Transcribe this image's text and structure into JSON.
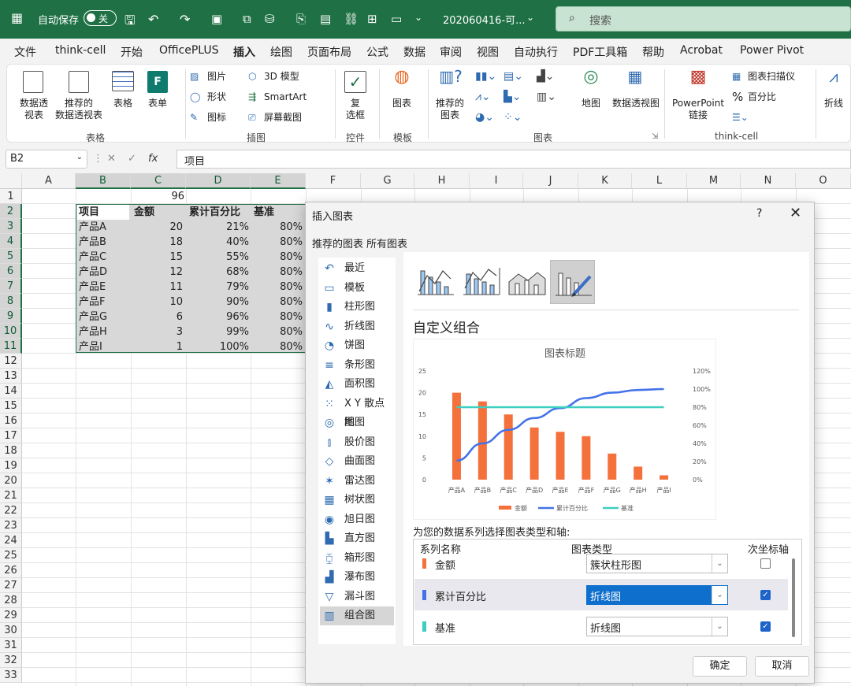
{
  "title_bar": {
    "autosave_label": "自动保存",
    "autosave_state": "关",
    "filename": "202060416-可...",
    "search_placeholder": "搜索"
  },
  "menu": [
    "文件",
    "think-cell",
    "开始",
    "OfficePLUS",
    "插入",
    "绘图",
    "页面布局",
    "公式",
    "数据",
    "审阅",
    "视图",
    "自动执行",
    "PDF工具箱",
    "帮助",
    "Acrobat",
    "Power Pivot"
  ],
  "menu_active": "插入",
  "ribbon": {
    "pivot_table": "数据透\n视表",
    "recommended_pivot": "推荐的\n数据透视表",
    "table": "表格",
    "form": "表单",
    "group_table": "表格",
    "pictures": "图片",
    "shapes": "形状",
    "icons": "图标",
    "model3d": "3D 模型",
    "smartart": "SmartArt",
    "screenshot": "屏幕截图",
    "group_illustrations": "插图",
    "checkbox": "复\n选框",
    "group_controls": "控件",
    "chart_template": "图表",
    "group_template": "模板",
    "recommended_charts": "推荐的\n图表",
    "maps": "地图",
    "pivot_chart": "数据透视图",
    "group_charts": "图表",
    "powerpoint_link": "PowerPoint\n链接",
    "chart_scanner": "图表扫描仪",
    "percent": "百分比",
    "group_thinkcell": "think-cell",
    "line_sparkline": "折线"
  },
  "formula_bar": {
    "name_box": "B2",
    "fx": "fx",
    "content": "项目"
  },
  "columns": [
    "A",
    "B",
    "C",
    "D",
    "E",
    "F",
    "G",
    "H",
    "I",
    "J",
    "K",
    "L",
    "M",
    "N",
    "O"
  ],
  "rows": [
    "1",
    "2",
    "3",
    "4",
    "5",
    "6",
    "7",
    "8",
    "9",
    "10",
    "11",
    "12",
    "13",
    "14",
    "15",
    "16",
    "17",
    "18",
    "19",
    "20",
    "21",
    "22",
    "23",
    "24",
    "25",
    "26",
    "27",
    "28",
    "29",
    "30",
    "31",
    "32",
    "33"
  ],
  "cell_c1": "96",
  "table_headers": [
    "项目",
    "金额",
    "累计百分比",
    "基准"
  ],
  "table_rows": [
    [
      "产品A",
      "20",
      "21%",
      "80%"
    ],
    [
      "产品B",
      "18",
      "40%",
      "80%"
    ],
    [
      "产品C",
      "15",
      "55%",
      "80%"
    ],
    [
      "产品D",
      "12",
      "68%",
      "80%"
    ],
    [
      "产品E",
      "11",
      "79%",
      "80%"
    ],
    [
      "产品F",
      "10",
      "90%",
      "80%"
    ],
    [
      "产品G",
      "6",
      "96%",
      "80%"
    ],
    [
      "产品H",
      "3",
      "99%",
      "80%"
    ],
    [
      "产品I",
      "1",
      "100%",
      "80%"
    ]
  ],
  "dialog": {
    "title": "插入图表",
    "help": "?",
    "close": "✕",
    "tab_recommended": "推荐的图表",
    "tab_all": "所有图表",
    "chart_types": [
      {
        "label": "最近",
        "icon": "↶"
      },
      {
        "label": "模板",
        "icon": "▭"
      },
      {
        "label": "柱形图",
        "icon": "▮"
      },
      {
        "label": "折线图",
        "icon": "∿"
      },
      {
        "label": "饼图",
        "icon": "◔"
      },
      {
        "label": "条形图",
        "icon": "≡"
      },
      {
        "label": "面积图",
        "icon": "◭"
      },
      {
        "label": "X Y 散点图",
        "icon": "⁙"
      },
      {
        "label": "地图",
        "icon": "◎"
      },
      {
        "label": "股价图",
        "icon": "⫾"
      },
      {
        "label": "曲面图",
        "icon": "◇"
      },
      {
        "label": "雷达图",
        "icon": "✶"
      },
      {
        "label": "树状图",
        "icon": "▦"
      },
      {
        "label": "旭日图",
        "icon": "◉"
      },
      {
        "label": "直方图",
        "icon": "▙"
      },
      {
        "label": "箱形图",
        "icon": "⧮"
      },
      {
        "label": "瀑布图",
        "icon": "▟"
      },
      {
        "label": "漏斗图",
        "icon": "▽"
      },
      {
        "label": "组合图",
        "icon": "▥"
      }
    ],
    "selected_type": "组合图",
    "subtype_heading": "自定义组合",
    "series_prompt": "为您的数据系列选择图表类型和轴:",
    "series_headers": [
      "系列名称",
      "图表类型",
      "次坐标轴"
    ],
    "series": [
      {
        "name": "金额",
        "color": "#f4713c",
        "chart_type": "簇状柱形图",
        "secondary_axis": false
      },
      {
        "name": "累计百分比",
        "color": "#4472e8",
        "chart_type": "折线图",
        "secondary_axis": true
      },
      {
        "name": "基准",
        "color": "#3ccfc0",
        "chart_type": "折线图",
        "secondary_axis": true
      }
    ],
    "ok": "确定",
    "cancel": "取消"
  },
  "chart_data": {
    "type": "bar",
    "title": "图表标题",
    "categories": [
      "产品A",
      "产品B",
      "产品C",
      "产品D",
      "产品E",
      "产品F",
      "产品G",
      "产品H",
      "产品I"
    ],
    "series": [
      {
        "name": "金额",
        "type": "bar",
        "axis": "primary",
        "color": "#f4713c",
        "values": [
          20,
          18,
          15,
          12,
          11,
          10,
          6,
          3,
          1
        ]
      },
      {
        "name": "累计百分比",
        "type": "line",
        "axis": "secondary",
        "color": "#4472e8",
        "values": [
          21,
          40,
          55,
          68,
          79,
          90,
          96,
          99,
          100
        ]
      },
      {
        "name": "基准",
        "type": "line",
        "axis": "secondary",
        "color": "#3ccfc0",
        "values": [
          80,
          80,
          80,
          80,
          80,
          80,
          80,
          80,
          80
        ]
      }
    ],
    "y_ticks": [
      "0",
      "5",
      "10",
      "15",
      "20",
      "25"
    ],
    "y2_ticks": [
      "0%",
      "20%",
      "40%",
      "60%",
      "80%",
      "100%",
      "120%"
    ],
    "ylim": [
      0,
      25
    ],
    "y2lim": [
      0,
      120
    ],
    "legend": "bottom",
    "grid": false
  }
}
